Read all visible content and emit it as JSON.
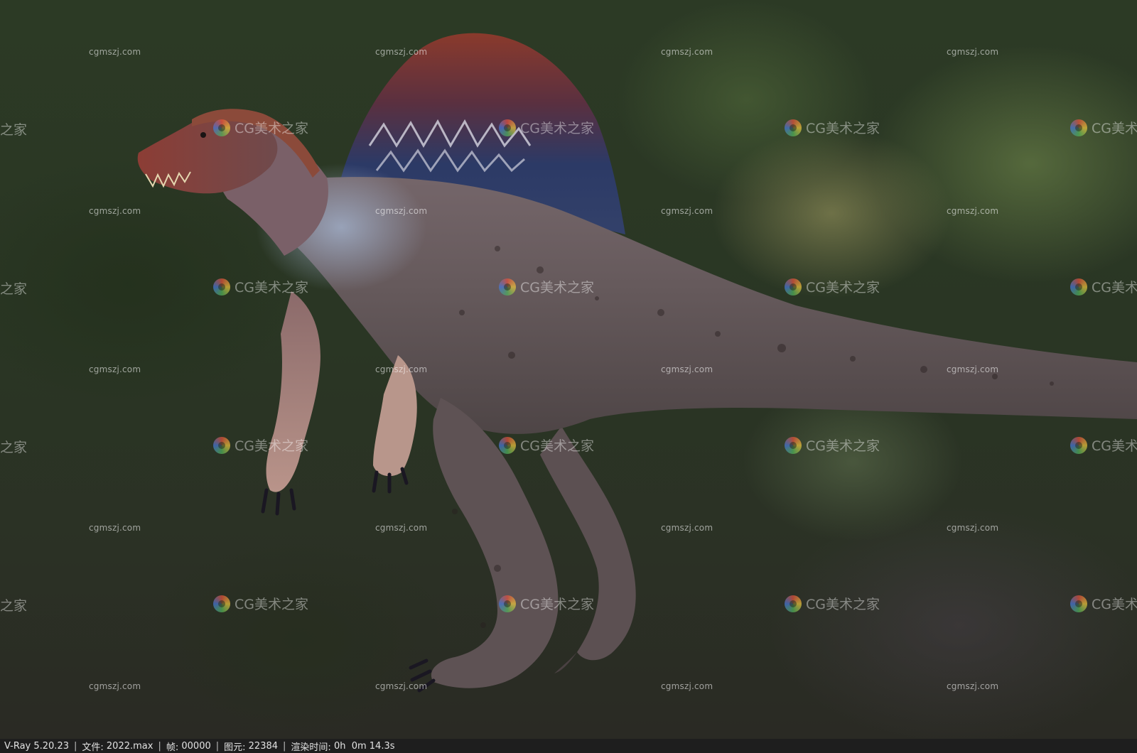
{
  "watermarks": {
    "small_text": "cgmszj.com",
    "logo_text": "CG美术之家",
    "logo_text_cut": "之家",
    "logo_text_cut_right": "CG美术"
  },
  "status_bar": {
    "renderer": "V-Ray 5.20.23",
    "file_label": "文件:",
    "file_value": "2022.max",
    "frame_label": "帧:",
    "frame_value": "00000",
    "primitives_label": "图元:",
    "primitives_value": "22384",
    "render_time_label": "渲染时间:",
    "render_time_value": "0h  0m 14.3s"
  }
}
